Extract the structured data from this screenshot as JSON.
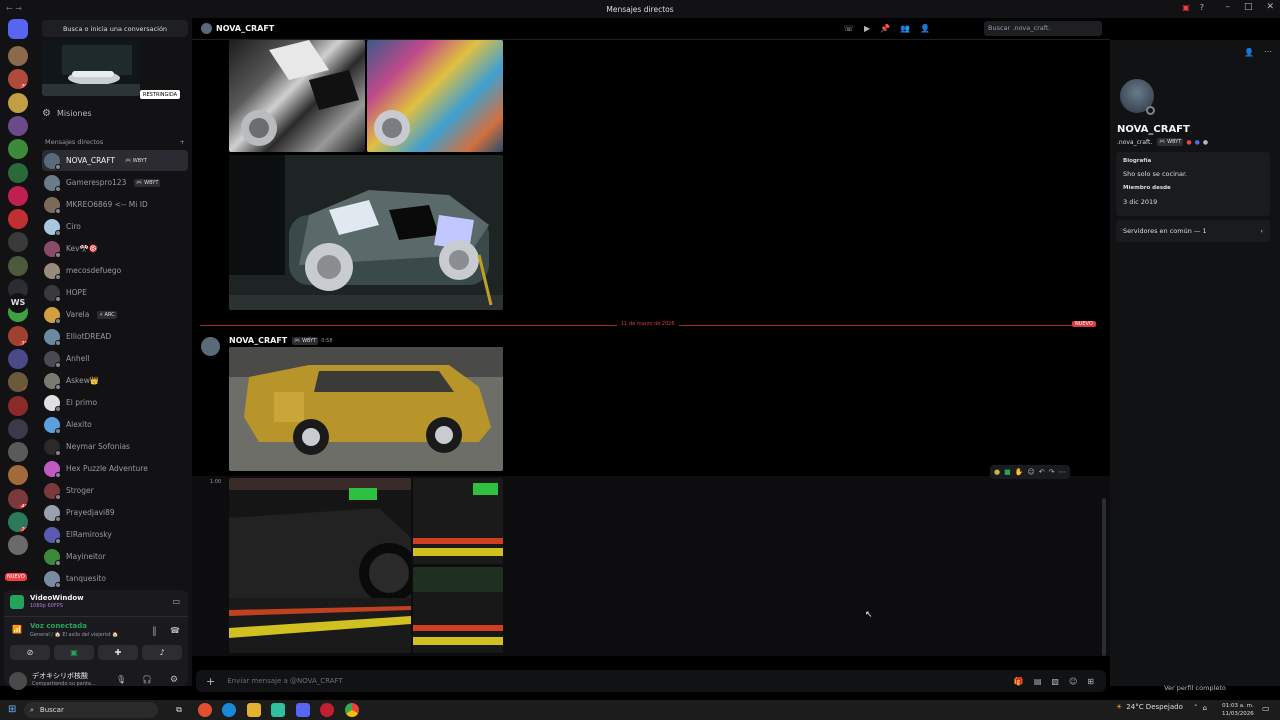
{
  "window": {
    "title": "Mensajes directos",
    "back_glyph": "←",
    "fwd_glyph": "→"
  },
  "sidebar": {
    "search_label": "Busca o inicia una conversación",
    "restricted_label": "RESTRINGIDA",
    "missions_label": "Misiones",
    "dm_header": "Mensajes directos",
    "add_glyph": "+",
    "dms": [
      {
        "name": "NOVA_CRAFT",
        "tag": "🎮 WBYT",
        "color": "#5b6a7a",
        "active": true
      },
      {
        "name": "Gamerespro123",
        "tag": "🎮 WBYT",
        "color": "#6a7c8a"
      },
      {
        "name": "MKREO6869 <-- Mi ID",
        "tag": "",
        "color": "#7a6a5a"
      },
      {
        "name": "Ciro",
        "tag": "",
        "color": "#a8c8e0"
      },
      {
        "name": "Kev🎌🎯",
        "tag": "",
        "color": "#8a4a6a"
      },
      {
        "name": "mecosdefuego",
        "tag": "",
        "color": "#9a8a7a"
      },
      {
        "name": "HOPE",
        "tag": "",
        "color": "#3a3a3a"
      },
      {
        "name": "Varela",
        "tag": "⚡ ARC",
        "color": "#d0a040"
      },
      {
        "name": "ElliotDREAD",
        "tag": "",
        "color": "#6a8aa0"
      },
      {
        "name": "Anhell",
        "tag": "",
        "color": "#4a4a55"
      },
      {
        "name": "Askew👑",
        "tag": "",
        "color": "#7a7a70"
      },
      {
        "name": "El primo",
        "tag": "",
        "color": "#e0e0e0"
      },
      {
        "name": "Alexito",
        "tag": "",
        "color": "#5aa0e0"
      },
      {
        "name": "Neymar Sofonias",
        "tag": "",
        "color": "#2a2a2a"
      },
      {
        "name": "Hex Puzzle Adventure",
        "tag": "",
        "color": "#c05ac0"
      },
      {
        "name": "Stroger",
        "tag": "",
        "color": "#7a3a3a"
      },
      {
        "name": "Prayedjavi89",
        "tag": "",
        "color": "#9aa0b0"
      },
      {
        "name": "ElRamirosky",
        "tag": "",
        "color": "#5a5ab0"
      },
      {
        "name": "Mayineitor",
        "tag": "",
        "color": "#3a8a3a"
      },
      {
        "name": "tanquesito",
        "tag": "",
        "color": "#7a8aa0"
      }
    ]
  },
  "rail": {
    "servers": [
      {
        "color": "#5865f2",
        "badge": ""
      },
      {
        "color": "#8a6a4a",
        "badge": ""
      },
      {
        "color": "#b04a3a",
        "badge": "38"
      },
      {
        "color": "#c0a040",
        "badge": ""
      },
      {
        "color": "#6a4a8a",
        "badge": ""
      },
      {
        "color": "#3a8a3a",
        "badge": ""
      },
      {
        "color": "#2a6a3a",
        "badge": ""
      },
      {
        "color": "#c02050",
        "badge": ""
      },
      {
        "color": "#c03030",
        "badge": ""
      },
      {
        "color": "#3a3a3a",
        "badge": ""
      },
      {
        "color": "#4a5a3a",
        "badge": ""
      },
      {
        "color": "#2b2d31",
        "badge": ""
      },
      {
        "color": "#40a040",
        "badge": ""
      },
      {
        "color": "#a04030",
        "badge": "18"
      },
      {
        "color": "#4a4a8a",
        "badge": ""
      },
      {
        "color": "#6a5a3a",
        "badge": "4"
      },
      {
        "color": "#8a2a2a",
        "badge": ""
      },
      {
        "color": "#3a3a4a",
        "badge": ""
      },
      {
        "color": "#5a5a5a",
        "badge": ""
      },
      {
        "color": "#a06a3a",
        "badge": ""
      },
      {
        "color": "#7a3a3a",
        "badge": "46"
      },
      {
        "color": "#2a7a5a",
        "badge": "24"
      },
      {
        "color": "#6a6a6a",
        "badge": ""
      }
    ],
    "ws_label": "WS",
    "new_label": "NUEVO"
  },
  "voice": {
    "app_name": "VideoWindow",
    "app_sub": "1080p 60FPS",
    "connected": "Voz conectada",
    "channel": "General / 🏠 El asilo del viejerist 🏠",
    "user_name": "デオキシリボ核酸",
    "user_status": "Compartiendo su panta..."
  },
  "chat": {
    "header_name": "NOVA_CRAFT",
    "search_placeholder": "Buscar .nova_craft.",
    "date_divider": "11 de marzo de 2026",
    "new_label": "NUEVO",
    "message_author": "NOVA_CRAFT",
    "message_tag": "🎮 WBYT",
    "message_time": "0:58",
    "hover_time": "1:00",
    "composer_placeholder": "Enviar mensaje a @NOVA_CRAFT"
  },
  "profile": {
    "display_name": "NOVA_CRAFT",
    "username": ".nova_craft.",
    "tag": "🎮 WBYT",
    "bio_label": "Biografía",
    "bio": "Sho solo se cocinar.",
    "member_label": "Miembro desde",
    "member_since": "3 dic 2019",
    "mutual": "Servidores en común — 1",
    "full_profile": "Ver perfil completo"
  },
  "taskbar": {
    "search": "Buscar",
    "weather": "24°C  Despejado",
    "time": "01:03 a. m.",
    "date": "11/03/2026"
  }
}
